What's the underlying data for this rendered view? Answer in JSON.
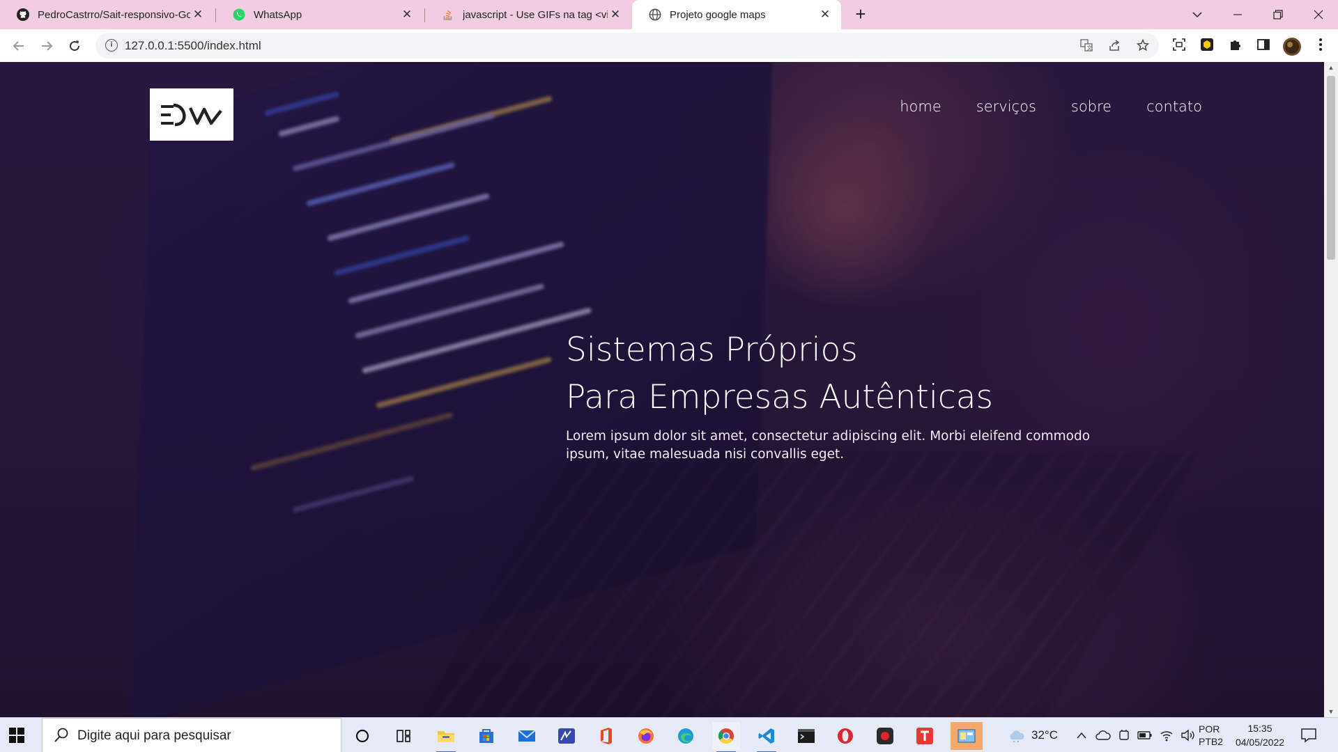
{
  "browser": {
    "tabs": [
      {
        "label": "PedroCastrro/Sait-responsivo-Go",
        "icon": "github-icon",
        "active": false
      },
      {
        "label": "WhatsApp",
        "icon": "whatsapp-icon",
        "active": false
      },
      {
        "label": "javascript - Use GIFs na tag <video",
        "icon": "stackoverflow-icon",
        "active": false
      },
      {
        "label": "Projeto google maps",
        "icon": "globe-icon",
        "active": true
      }
    ],
    "new_tab_symbol": "+",
    "close_symbol": "✕",
    "address": "127.0.0.1:5500/index.html"
  },
  "site": {
    "logo_text": "=DW",
    "nav": [
      "home",
      "serviços",
      "sobre",
      "contato"
    ],
    "headline_line1": "Sistemas Próprios",
    "headline_line2": "Para Empresas Autênticas",
    "lead": "Lorem ipsum dolor sit amet, consectetur adipiscing elit. Morbi eleifend commodo ipsum, vitae malesuada nisi convallis eget."
  },
  "taskbar": {
    "search_placeholder": "Digite aqui para pesquisar",
    "weather": "32°C",
    "language_line1": "POR",
    "language_line2": "PTB2",
    "time": "15:35",
    "date": "04/05/2022"
  },
  "colors": {
    "tabstrip": "#f1cde2",
    "nav_text": "#ffffff",
    "accent": "#2f6fd0"
  }
}
